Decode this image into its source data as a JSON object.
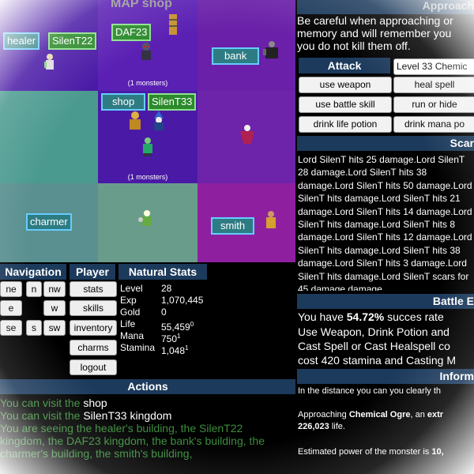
{
  "map": {
    "title": "MAP shop",
    "cells": [
      {
        "color": "#4a1aa6"
      },
      {
        "color": "#5a1fb3"
      },
      {
        "color": "#6a20a8"
      },
      {
        "color": "#4b9a90"
      },
      {
        "color": "#4a1aa6"
      },
      {
        "color": "#6d23aa"
      },
      {
        "color": "#5a9090"
      },
      {
        "color": "#6a9c8c"
      },
      {
        "color": "#8e20a0"
      }
    ],
    "tags": {
      "healer": "healer",
      "silent22": "SilenT22",
      "daf23": "DAF23",
      "bank": "bank",
      "shop": "shop",
      "silent33": "SilenT33",
      "charmer": "charmer",
      "smith": "smith"
    },
    "monster_count_1": "(1 monsters)",
    "monster_count_2": "(1 monsters)"
  },
  "navigation": {
    "title": "Navigation",
    "buttons": [
      "ne",
      "n",
      "nw",
      "e",
      "w",
      "se",
      "s",
      "sw"
    ]
  },
  "player": {
    "title": "Player",
    "buttons": [
      "stats",
      "skills",
      "inventory",
      "charms",
      "logout"
    ]
  },
  "natural_stats": {
    "title": "Natural Stats",
    "rows": [
      {
        "label": "Level",
        "value": "28",
        "sup": ""
      },
      {
        "label": "Exp",
        "value": "1,070,445",
        "sup": ""
      },
      {
        "label": "Gold",
        "value": "0",
        "sup": ""
      },
      {
        "label": "Life",
        "value": "55,459",
        "sup": "0"
      },
      {
        "label": "Mana",
        "value": "750",
        "sup": "1"
      },
      {
        "label": "Stamina",
        "value": "1,048",
        "sup": "1"
      }
    ]
  },
  "actions": {
    "title": "Actions",
    "line1_prefix": "You can visit the ",
    "line1_link": "shop",
    "line2_prefix": "You can visit the ",
    "line2_link": "SilenT33 kingdom",
    "line3": "You are seeing the healer's building, the SilenT22 kingdom, the DAF23 kingdom, the bank's building, the charmer's building, the smith's building,"
  },
  "right": {
    "approach_title": "Approach",
    "intro": "Be careful when approaching or memory and will remember you you do not kill them off.",
    "attack_title": "Attack",
    "level_select": "Level 33 Chemic",
    "buttons": [
      "use weapon",
      "heal spell",
      "use battle skill",
      "run or hide",
      "drink life potion",
      "drink mana po"
    ],
    "scars_title": "Scar",
    "combat_log": "Lord SilenT hits 25 damage.Lord SilenT 28 damage.Lord SilenT hits 38 damage.Lord SilenT hits 50 damage.Lord SilenT hits damage.Lord SilenT hits 21 damage.Lord SilenT hits 14 damage.Lord SilenT hits damage.Lord SilenT hits 8 damage.Lord SilenT hits 12 damage.Lord SilenT hits damage.Lord SilenT hits 38 damage.Lord SilenT hits 3 damage.Lord SilenT hits damage.Lord SilenT scars for 45 damage damage.",
    "battle_title": "Battle E",
    "success_prefix": "You have ",
    "success_pct": "54.72%",
    "success_suffix": " succes rate",
    "battle_text": "Use Weapon, Drink Potion and Cast Spell or Cast Healspell co cost 420 stamina and Casting M",
    "info_title": "Inform",
    "info_line1": "In the distance you can you clearly th",
    "approaching_prefix": "Approaching ",
    "monster_name": "Chemical Ogre",
    "approaching_mid": ", an ",
    "approaching_bold": "extr",
    "monster_life": "226,023",
    "life_suffix": " life.",
    "power_prefix": "Estimated power of the monster is ",
    "power_value": "10,"
  }
}
